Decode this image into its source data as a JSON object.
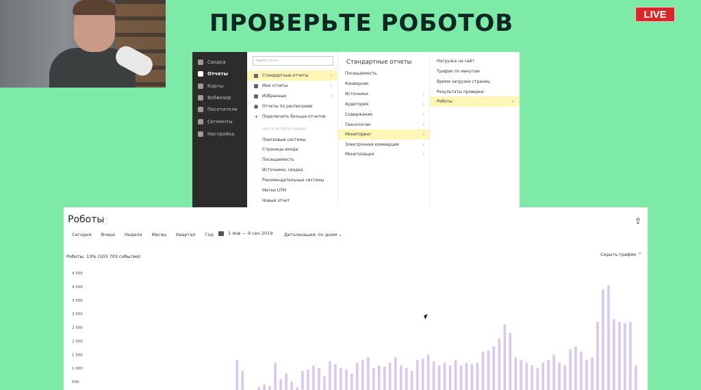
{
  "stream": {
    "live_label": "LIVE",
    "headline": "ПРОВЕРЬТЕ РОБОТОВ"
  },
  "colors": {
    "background": "#7eeaa8",
    "live": "#d8262a",
    "nav_dark": "#2c2c2c",
    "highlight": "#fff6b8",
    "bar": "#d9c8ee"
  },
  "metrika_menu": {
    "nav": [
      {
        "label": "Сводка",
        "icon": "dashboard-icon"
      },
      {
        "label": "Отчеты",
        "icon": "reports-icon",
        "active": true
      },
      {
        "label": "Карты",
        "icon": "maps-icon"
      },
      {
        "label": "Вебвизор",
        "icon": "webvisor-icon"
      },
      {
        "label": "Посетители",
        "icon": "visitors-icon"
      },
      {
        "label": "Сегменты",
        "icon": "segments-icon"
      },
      {
        "label": "Настройка",
        "icon": "settings-icon"
      }
    ],
    "search_placeholder": "Найти отчет",
    "col1": [
      {
        "label": "Стандартные отчеты",
        "highlighted": true,
        "chevron": true
      },
      {
        "label": "Мои отчеты",
        "chevron": true
      },
      {
        "label": "Избранные",
        "chevron": true
      },
      {
        "label": "Отчеты по расписанию"
      },
      {
        "label": "Подключить больше отчетов"
      }
    ],
    "col1_caption": "ЧАСТО ИСПОЛЬЗУЕМЫЕ",
    "col1_frequent": [
      "Поисковые системы",
      "Страницы входа",
      "Посещаемость",
      "Источники, сводка",
      "Рекомендательные системы",
      "Метки UTM",
      "Новый отчет"
    ],
    "col2_title": "Стандартные отчеты",
    "col2": [
      {
        "label": "Посещаемость"
      },
      {
        "label": "Конверсии"
      },
      {
        "label": "Источники",
        "chevron": true
      },
      {
        "label": "Аудитория",
        "chevron": true
      },
      {
        "label": "Содержание",
        "chevron": true
      },
      {
        "label": "Технологии",
        "chevron": true
      },
      {
        "label": "Мониторинг",
        "chevron": true,
        "highlighted": true
      },
      {
        "label": "Электронная коммерция",
        "chevron": true
      },
      {
        "label": "Монетизация",
        "chevron": true
      }
    ],
    "col3": [
      {
        "label": "Нагрузка на сайт"
      },
      {
        "label": "Трафик по минутам"
      },
      {
        "label": "Время загрузки страниц"
      },
      {
        "label": "Результаты проверки"
      },
      {
        "label": "Роботы",
        "highlighted": true,
        "check": "✓"
      }
    ]
  },
  "report": {
    "title": "Роботы",
    "periods": [
      "Сегодня",
      "Вчера",
      "Неделя",
      "Месяц",
      "Квартал",
      "Год"
    ],
    "date_range": "1 янв — 9 сен 2019",
    "detail": "Детализация: по дням",
    "summary": "Роботы: 13% (103 703 события)",
    "hide_chart": "Скрыть график"
  },
  "chart_data": {
    "type": "bar",
    "ylabel": "",
    "xlabel": "",
    "ylim": [
      0,
      4500
    ],
    "yticks": [
      "4 500",
      "4 000",
      "3 500",
      "3 000",
      "2 500",
      "2 000",
      "1 500",
      "1 000",
      "500"
    ],
    "series": [
      {
        "values": [
          120,
          90,
          60,
          80,
          40,
          110,
          70,
          50,
          180,
          90,
          60,
          100,
          140,
          80,
          60,
          110,
          95,
          70,
          130,
          60,
          90,
          120,
          80,
          110,
          70,
          150,
          180,
          1300,
          900,
          200,
          150,
          300,
          400,
          350,
          1200,
          600,
          800,
          500,
          300,
          900,
          950,
          1100,
          1000,
          700,
          1250,
          1150,
          1000,
          950,
          800,
          1200,
          1300,
          1400,
          1000,
          1100,
          1050,
          1200,
          1400,
          1100,
          1000,
          900,
          1300,
          1350,
          1500,
          1250,
          1100,
          1200,
          1100,
          1300,
          1100,
          1200,
          1150,
          1200,
          1600,
          1650,
          1800,
          2100,
          2600,
          2300,
          1400,
          1300,
          1200,
          1100,
          1000,
          1200,
          1300,
          1500,
          1200,
          1100,
          1700,
          1800,
          1600,
          1300,
          1400,
          2700,
          3900,
          4050,
          2800,
          2700,
          2650,
          2700,
          1100
        ]
      }
    ]
  }
}
